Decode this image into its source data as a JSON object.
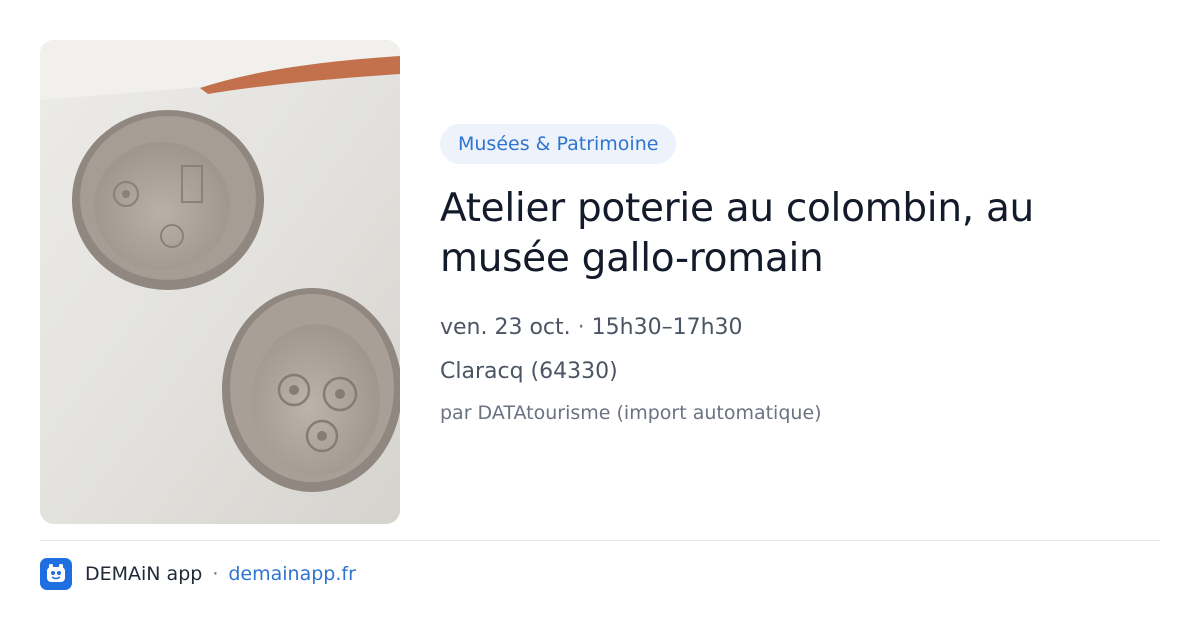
{
  "event": {
    "category": "Musées & Patrimoine",
    "title_line1": "Atelier poterie au colombin, au",
    "title_line2": "musée gallo-romain",
    "date": "ven. 23 oct.",
    "date_time_separator": "·",
    "time": "15h30–17h30",
    "location": "Claracq (64330)",
    "source": "par DATAtourisme (import automatique)"
  },
  "image": {
    "description_icon": "pottery-photo"
  },
  "footer": {
    "app_name": "DEMAiN app",
    "separator": "·",
    "domain": "demainapp.fr",
    "logo_icon": "demain-logo-icon"
  },
  "colors": {
    "accent": "#2f74d0",
    "badge_bg": "#eef3fb",
    "logo_bg": "#1f6fe0"
  }
}
